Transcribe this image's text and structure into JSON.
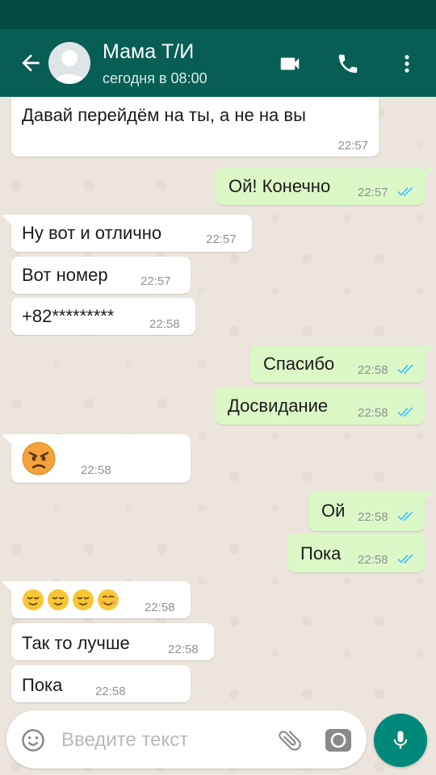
{
  "header": {
    "title": "Мама Т/И",
    "subtitle": "сегодня в 08:00"
  },
  "messages": [
    {
      "dir": "in",
      "text": "Давай перейдём на ты, а не на вы",
      "time": "22:57"
    },
    {
      "dir": "out",
      "text": "Ой! Конечно",
      "time": "22:57",
      "read": true
    },
    {
      "dir": "in",
      "text": "Ну вот и отлично",
      "time": "22:57"
    },
    {
      "dir": "in",
      "text": "Вот номер",
      "time": "22:57"
    },
    {
      "dir": "in",
      "text": "+82*********",
      "time": "22:58"
    },
    {
      "dir": "out",
      "text": "Спасибо",
      "time": "22:58",
      "read": true
    },
    {
      "dir": "out",
      "text": "Досвидание",
      "time": "22:58",
      "read": true
    },
    {
      "dir": "in",
      "emoji": "angry-face",
      "time": "22:58"
    },
    {
      "dir": "out",
      "text": "Ой",
      "time": "22:58",
      "read": true
    },
    {
      "dir": "out",
      "text": "Пока",
      "time": "22:58",
      "read": true
    },
    {
      "dir": "in",
      "emoji": "relieved-face x3, smiling-face x1",
      "time": "22:58"
    },
    {
      "dir": "in",
      "text": "Так то лучше",
      "time": "22:58"
    },
    {
      "dir": "in",
      "text": "Пока",
      "time": "22:58"
    }
  ],
  "input": {
    "placeholder": "Введите текст"
  },
  "icons": {
    "back": "arrow-back-icon",
    "video": "videocam-icon",
    "call": "phone-icon",
    "menu": "more-vert-icon",
    "emoji": "emoji-icon",
    "attach": "paperclip-icon",
    "camera": "camera-icon",
    "mic": "mic-icon",
    "read_receipt": "double-check-icon"
  },
  "colors": {
    "appbar": "#075e54",
    "statusbar": "#054d44",
    "outgoing_bubble": "#dcf8c6",
    "incoming_bubble": "#ffffff",
    "read_tick": "#4fc3f7",
    "mic_button": "#00897b"
  }
}
